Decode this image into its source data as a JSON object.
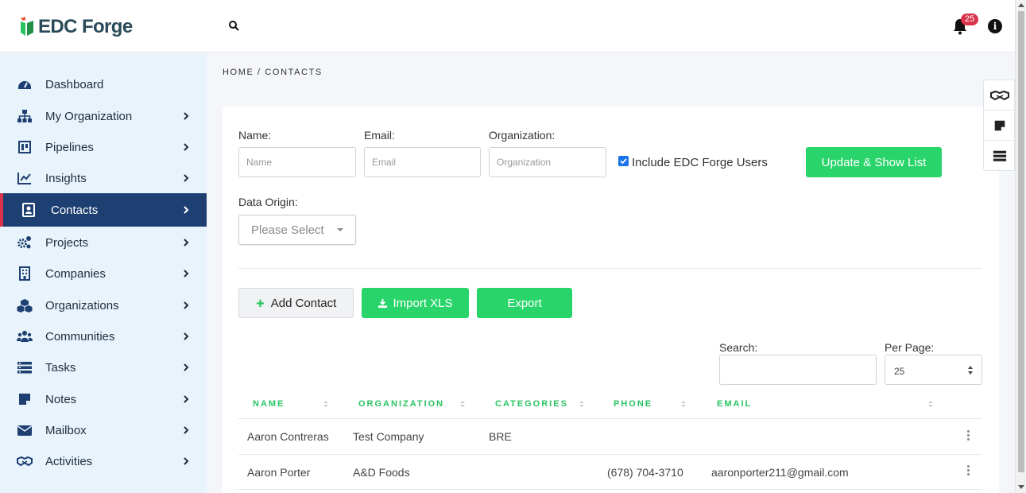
{
  "header": {
    "logo_text": "EDC Forge",
    "notification_count": "25",
    "info_glyph": "i",
    "icons": [
      "search-icon",
      "bell-icon",
      "info-icon"
    ]
  },
  "sidebar": {
    "items": [
      {
        "label": "Dashboard",
        "icon": "dashboard-icon",
        "has_children": false
      },
      {
        "label": "My Organization",
        "icon": "org-chart-icon",
        "has_children": true
      },
      {
        "label": "Pipelines",
        "icon": "pipeline-board-icon",
        "has_children": true
      },
      {
        "label": "Insights",
        "icon": "chart-line-icon",
        "has_children": true
      },
      {
        "label": "Contacts",
        "icon": "contact-card-icon",
        "has_children": true,
        "active": true
      },
      {
        "label": "Projects",
        "icon": "cogs-icon",
        "has_children": true
      },
      {
        "label": "Companies",
        "icon": "building-icon",
        "has_children": true
      },
      {
        "label": "Organizations",
        "icon": "cubes-icon",
        "has_children": true
      },
      {
        "label": "Communities",
        "icon": "users-icon",
        "has_children": true
      },
      {
        "label": "Tasks",
        "icon": "tasks-icon",
        "has_children": true
      },
      {
        "label": "Notes",
        "icon": "note-icon",
        "has_children": true
      },
      {
        "label": "Mailbox",
        "icon": "envelope-icon",
        "has_children": true
      },
      {
        "label": "Activities",
        "icon": "handshake-icon",
        "has_children": true
      }
    ]
  },
  "breadcrumb": "HOME / CONTACTS",
  "filters": {
    "name_label": "Name:",
    "name_placeholder": "Name",
    "email_label": "Email:",
    "email_placeholder": "Email",
    "organization_label": "Organization:",
    "organization_placeholder": "Organization",
    "include_users_label": "Include EDC Forge Users",
    "include_users_checked": true,
    "update_button": "Update & Show List",
    "data_origin_label": "Data Origin:",
    "data_origin_value": "Please Select"
  },
  "actions": {
    "add_contact": "Add Contact",
    "import_xls": "Import XLS",
    "export": "Export"
  },
  "table_controls": {
    "search_label": "Search:",
    "search_value": "",
    "per_page_label": "Per Page:",
    "per_page_value": "25"
  },
  "table": {
    "columns": [
      "NAME",
      "ORGANIZATION",
      "CATEGORIES",
      "PHONE",
      "EMAIL"
    ],
    "rows": [
      {
        "name": "Aaron Contreras",
        "organization": "Test Company",
        "categories": "BRE",
        "phone": "",
        "email": ""
      },
      {
        "name": "Aaron Porter",
        "organization": "A&D Foods",
        "categories": "",
        "phone": "(678) 704-3710",
        "email": "aaronporter211@gmail.com"
      }
    ]
  },
  "colors": {
    "accent_green": "#29d56a",
    "active_nav": "#1e3f72",
    "badge_red": "#d9334c",
    "sidebar_bg": "#e8f3fb"
  }
}
